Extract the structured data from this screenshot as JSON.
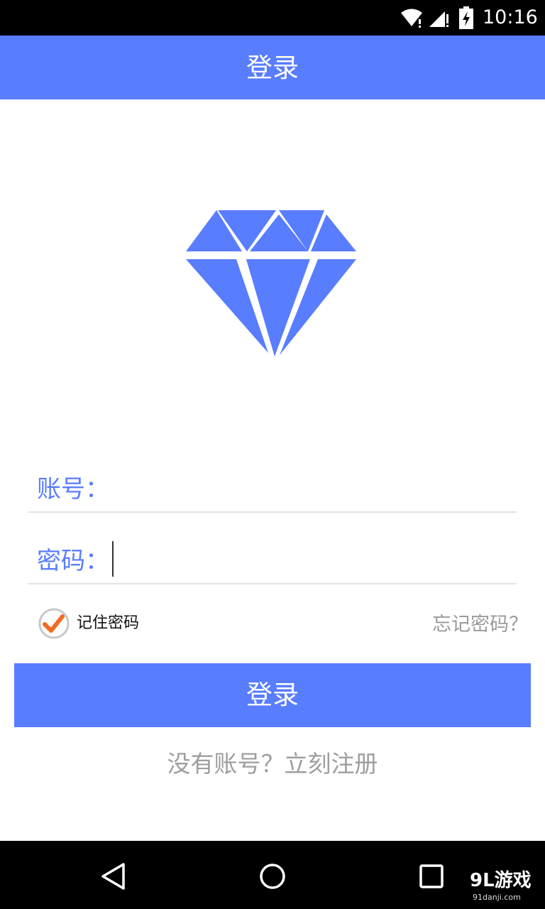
{
  "status_bar": {
    "time": "10:16",
    "icons": [
      "wifi-icon",
      "signal-icon",
      "battery-charging-icon"
    ]
  },
  "app_bar": {
    "title": "登录"
  },
  "logo": {
    "icon": "diamond-icon",
    "color": "#597dff"
  },
  "form": {
    "account": {
      "label": "账号：",
      "value": "",
      "placeholder": ""
    },
    "password": {
      "label": "密码：",
      "value": "",
      "placeholder": ""
    }
  },
  "remember": {
    "label": "记住密码",
    "checked": true
  },
  "forgot_label": "忘记密码？",
  "login_button_label": "登录",
  "register_label": "没有账号？立刻注册",
  "nav_bar": {
    "icons": [
      "back-icon",
      "home-icon",
      "recent-apps-icon"
    ]
  },
  "watermark": {
    "main": "9L游戏",
    "sub": "91danji.com"
  },
  "colors": {
    "accent": "#597dff",
    "check": "#f26b22",
    "muted_text": "#9e9e9e"
  }
}
